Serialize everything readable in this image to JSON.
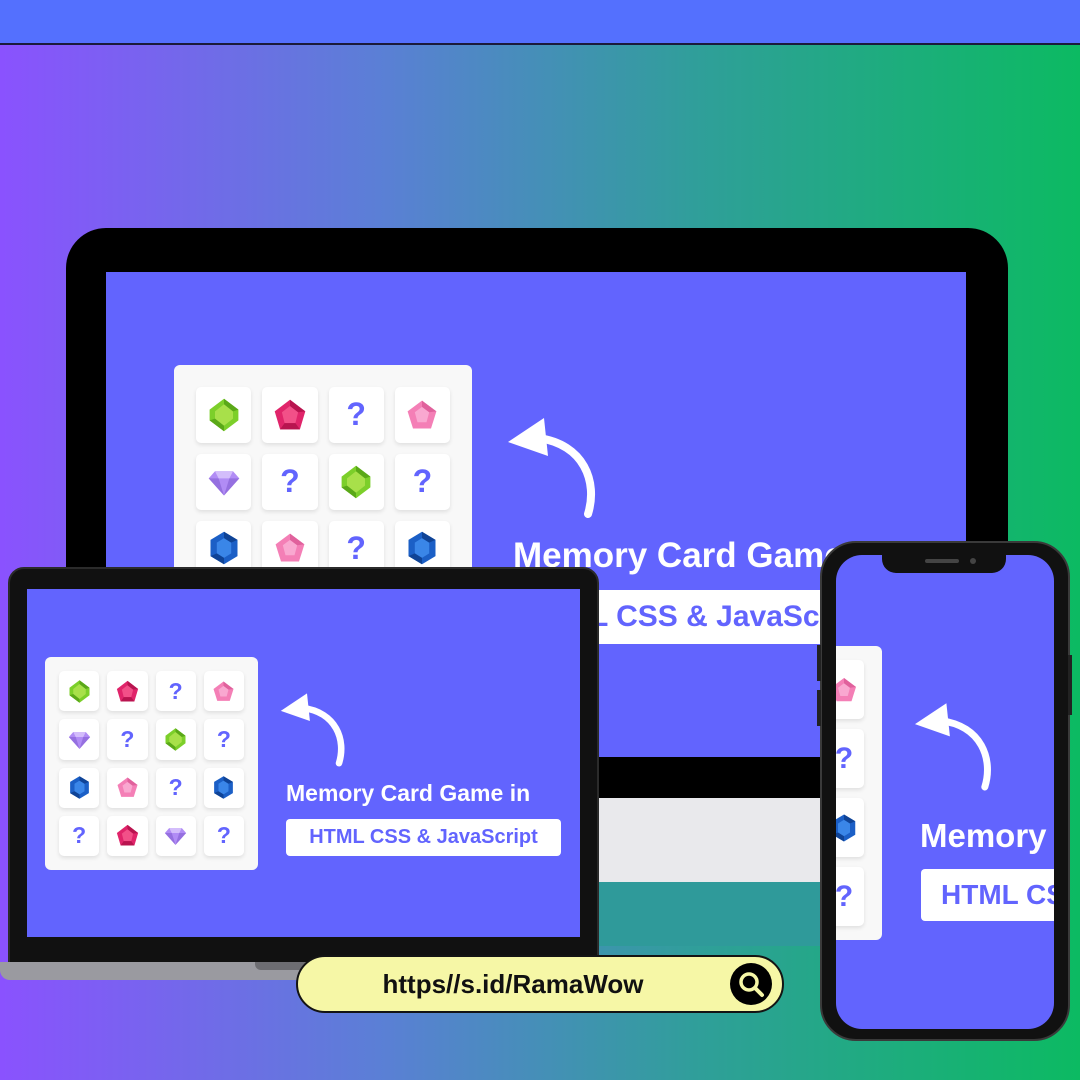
{
  "colors": {
    "screen_bg": "#6264fe",
    "board_bg": "#f8f8f8",
    "accent": "#6264fe",
    "url_pill_bg": "#f6f7a6"
  },
  "monitor": {
    "title": "Memory Card Game",
    "subtitle": "L CSS & JavaSc"
  },
  "laptop": {
    "title": "Memory Card Game in",
    "subtitle": "HTML CSS & JavaScript"
  },
  "phone": {
    "title": "Memory",
    "subtitle": "HTML CS"
  },
  "hidden_card_symbol": "?",
  "card_grid": [
    "green-gem-icon",
    "red-gem-icon",
    "?",
    "pink-gem-icon",
    "purple-diamond-icon",
    "?",
    "green-gem-icon",
    "?",
    "blue-gem-icon",
    "pink-gem-icon",
    "?",
    "blue-gem-icon",
    "?",
    "red-gem-icon",
    "purple-diamond-icon",
    "?"
  ],
  "phone_cards": [
    "pink-gem-icon",
    "?",
    "blue-gem-icon",
    "?"
  ],
  "url": {
    "text": "https//s.id/RamaWow",
    "icon": "search-icon"
  }
}
